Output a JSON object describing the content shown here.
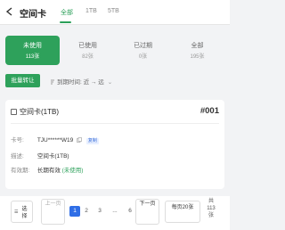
{
  "header": {
    "title": "空间卡",
    "tabs": [
      {
        "label": "全部",
        "active": true
      },
      {
        "label": "1TB",
        "active": false
      },
      {
        "label": "5TB",
        "active": false
      }
    ]
  },
  "stats": [
    {
      "label": "未使用",
      "count": "113张",
      "active": true
    },
    {
      "label": "已使用",
      "count": "82张",
      "active": false
    },
    {
      "label": "已过期",
      "count": "0张",
      "active": false
    },
    {
      "label": "全部",
      "count": "195张",
      "active": false
    }
  ],
  "toolbar": {
    "batch_label": "批量转让",
    "sort_label": "到期时间: 近 → 远"
  },
  "card": {
    "title": "空间卡(1TB)",
    "number": "#001",
    "card_no_key": "卡号:",
    "card_no_value": "TJU******W19",
    "copy_label": "复制",
    "desc_key": "描述:",
    "desc_value": "空间卡(1TB)",
    "validity_key": "有效期:",
    "validity_value": "长期有效",
    "validity_status": "(未使用)"
  },
  "pagination": {
    "select_label": "选择",
    "prev_label": "上一页",
    "next_label": "下一页",
    "pages": [
      "1",
      "2",
      "3",
      "...",
      "6"
    ],
    "current_page": "1",
    "per_page_label": "每页20张",
    "total_label": "共113张"
  },
  "colors": {
    "accent": "#2ea15b",
    "page_active": "#2f6ee6"
  }
}
